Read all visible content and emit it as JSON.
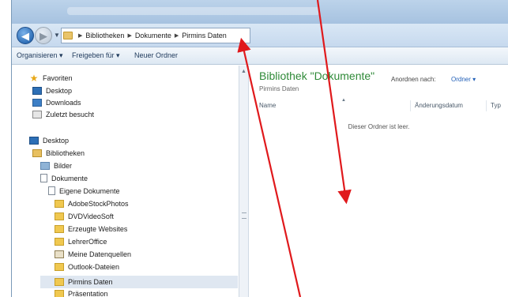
{
  "address": {
    "crumbs": [
      "Bibliotheken",
      "Dokumente",
      "Pirmins Daten"
    ]
  },
  "toolbar": {
    "organize": "Organisieren ▾",
    "share": "Freigeben für ▾",
    "new_folder": "Neuer Ordner"
  },
  "nav": {
    "favorites": "Favoriten",
    "desktop_fav": "Desktop",
    "downloads": "Downloads",
    "recent": "Zuletzt besucht",
    "desktop": "Desktop",
    "libraries": "Bibliotheken",
    "pictures": "Bilder",
    "documents": "Dokumente",
    "my_documents": "Eigene Dokumente",
    "folders": [
      "AdobeStockPhotos",
      "DVDVideoSoft",
      "Erzeugte Websites",
      "LehrerOffice",
      "Meine Datenquellen",
      "Outlook-Dateien",
      "Pirmins Daten",
      "Präsentation"
    ]
  },
  "content": {
    "title": "Bibliothek \"Dokumente\"",
    "subtitle": "Pirmins Daten",
    "arrange_label": "Anordnen nach:",
    "arrange_value": "Ordner ▾",
    "columns": {
      "name": "Name",
      "date": "Änderungsdatum",
      "type": "Typ"
    },
    "empty": "Dieser Ordner ist leer."
  },
  "colors": {
    "annotation_arrow": "#e0191c",
    "library_title": "#2f8a38"
  },
  "icons": {
    "back": "back-arrow-icon",
    "forward": "forward-arrow-icon"
  }
}
